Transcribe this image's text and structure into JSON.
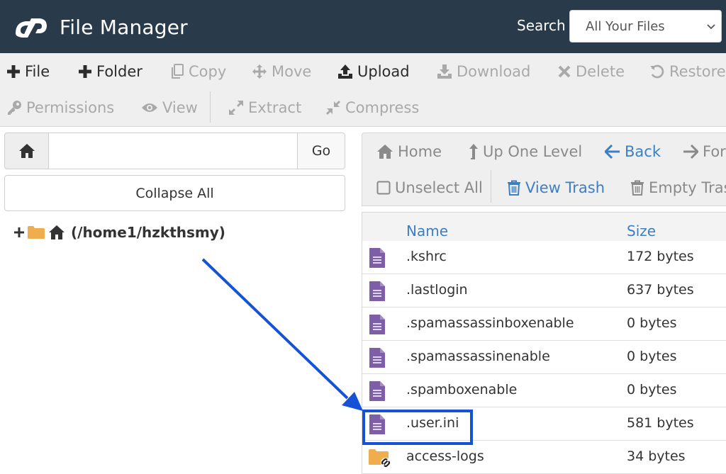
{
  "header": {
    "title": "File Manager",
    "logo_icon": "cpanel-logo-icon",
    "search_label": "Search",
    "search_scope": "All Your Files"
  },
  "toolbar": {
    "row1": [
      {
        "id": "file",
        "label": "File",
        "icon": "plus-icon",
        "enabled": true
      },
      {
        "id": "folder",
        "label": "Folder",
        "icon": "plus-icon",
        "enabled": true
      },
      {
        "id": "copy",
        "label": "Copy",
        "icon": "copy-icon",
        "enabled": false
      },
      {
        "id": "move",
        "label": "Move",
        "icon": "move-icon",
        "enabled": false
      },
      {
        "id": "upload",
        "label": "Upload",
        "icon": "upload-icon",
        "enabled": true
      },
      {
        "id": "download",
        "label": "Download",
        "icon": "download-icon",
        "enabled": false
      },
      {
        "id": "delete",
        "label": "Delete",
        "icon": "delete-icon",
        "enabled": false
      },
      {
        "id": "restore",
        "label": "Restore",
        "icon": "restore-icon",
        "enabled": false
      }
    ],
    "row2": [
      {
        "id": "permissions",
        "label": "Permissions",
        "icon": "key-icon",
        "enabled": false
      },
      {
        "id": "view",
        "label": "View",
        "icon": "eye-icon",
        "enabled": false
      },
      {
        "id": "extract",
        "label": "Extract",
        "icon": "expand-icon",
        "enabled": false
      },
      {
        "id": "compress",
        "label": "Compress",
        "icon": "compress-icon",
        "enabled": false
      }
    ]
  },
  "left_panel": {
    "path_value": "",
    "go_label": "Go",
    "collapse_label": "Collapse All",
    "tree_root_label": "(/home1/hzkthsmy)"
  },
  "navigation": {
    "home_label": "Home",
    "up_label": "Up One Level",
    "back_label": "Back",
    "forward_label": "Forward",
    "unselect_label": "Unselect All",
    "view_trash_label": "View Trash",
    "empty_trash_label": "Empty Trash"
  },
  "table": {
    "columns": {
      "name": "Name",
      "size": "Size"
    },
    "rows": [
      {
        "name": ".kshrc",
        "size": "172 bytes",
        "type": "file"
      },
      {
        "name": ".lastlogin",
        "size": "637 bytes",
        "type": "file"
      },
      {
        "name": ".spamassassinboxenable",
        "size": "0 bytes",
        "type": "file"
      },
      {
        "name": ".spamassassinenable",
        "size": "0 bytes",
        "type": "file"
      },
      {
        "name": ".spamboxenable",
        "size": "0 bytes",
        "type": "file"
      },
      {
        "name": ".user.ini",
        "size": "581 bytes",
        "type": "file"
      },
      {
        "name": "access-logs",
        "size": "34 bytes",
        "type": "folder-link"
      }
    ]
  },
  "colors": {
    "header_bg": "#293a4a",
    "link_blue": "#3b7fc4",
    "file_icon": "#7e5ea7",
    "folder_icon": "#f0ad4e",
    "annotation_blue": "#1553d6"
  }
}
